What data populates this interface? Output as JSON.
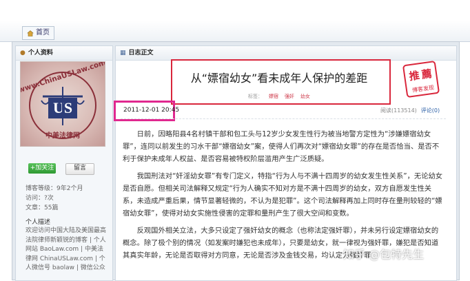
{
  "nav": {
    "home_label": "首页"
  },
  "sidebar": {
    "title": "个人资料",
    "avatar_text": "www.ChinaUSLaw.com",
    "avatar_bottom_text": "中美法律网",
    "follow_button": "+加关注",
    "message_button": "留言",
    "stats": [
      "博客等级：9年2个月",
      "访问：?次",
      "文章：55篇"
    ],
    "desc_title": "个人描述",
    "desc_text": "欢迎访问中国大陆及美国最高法院律师新颖锐的博客 | 个人网站 BaoLaw.com | 中美法律网 ChinaUSLaw.com | 个人微信号 baolaw | 微信公众"
  },
  "article": {
    "panel_title": "日志正文",
    "title": "从“嫖宿幼女”看未成年人保护的差距",
    "tags_label": "标签：",
    "tags": [
      "嫖宿",
      "强奸",
      "幼女"
    ],
    "stamp_text": [
      "推",
      "薦",
      "博客",
      "发现"
    ],
    "date": "2011-12-01 20:45",
    "read_label": "阅读(113514)",
    "comment_label": "评论(0)",
    "paragraphs": [
      "日前，因略阳县4名村镇干部和包工头与12岁少女发生性行为被当地警方定性为“涉嫌嫖宿幼女罪”，连同以前发生的习水干部“嫖宿幼女”案，使得人们再次对“嫖宿幼女罪”的存在是否恰当、是否不利于保护未成年人权益、是否容易被特权阶层滥用产生广泛质疑。",
      "我国刑法对“奸淫幼女罪”有专门定义，特指“行为人与不满十四周岁的幼女发生性关系”，无论幼女是否自愿。但相关司法解释又规定“行为人确实不知对方是不满十四周岁的幼女，双方自愿发生性关系，未造成严重后果，情节显著轻微的，不认为是犯罪”。这个司法解释再加上同时存在量刑较轻的“嫖宿幼女罪”，使得对幼女实施性侵害的定罪和量刑产生了很大空间和变数。",
      "反观国外相关立法，大多只设定了强奸幼女的概念（也称法定强奸罪），并未另行设定嫖宿幼女的概念。除了极个别的情况（如发案时嫌犯也未成年），只要是幼女，就一律视为强奸罪，嫌犯是否知道其真实年龄，无论是否取得对方同意，无论是否涉及金钱交易，均认定为强奸罪"
    ]
  },
  "watermark": "知乎 @包特先生",
  "colors": {
    "highlight_red": "#d9263b",
    "highlight_pink": "#e0288f",
    "follow_green": "#2f9a33"
  }
}
